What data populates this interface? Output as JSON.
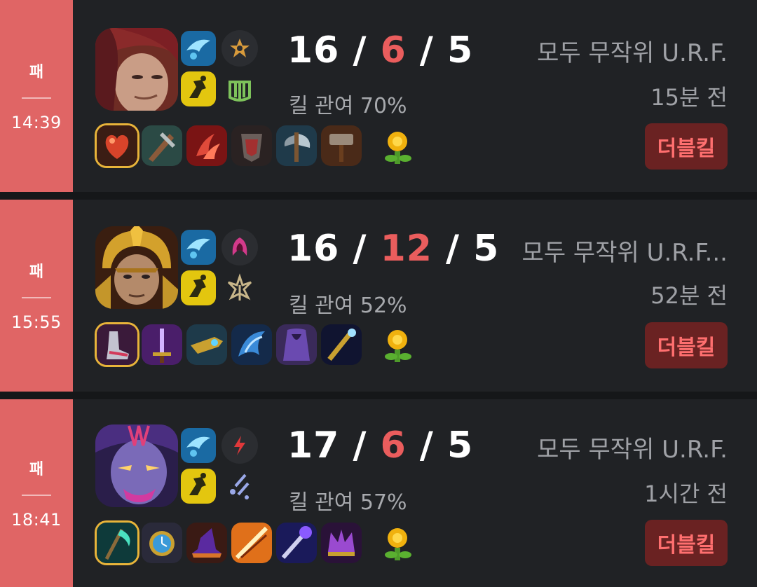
{
  "matches": [
    {
      "result": "패",
      "duration": "14:39",
      "kills": "16",
      "deaths": "6",
      "assists": "5",
      "kill_participation": "킬 관여 70%",
      "mode": "모두 무작위 U.R.F.",
      "time_ago": "15분 전",
      "badge": "더블킬",
      "champion_icon": "champion-portrait-red-hair",
      "spells": [
        "flash-icon",
        "ghost-icon"
      ],
      "runes": [
        "precision-keystone-icon",
        "resolve-rune-icon"
      ],
      "items": [
        "item-heart-icon",
        "item-blade-icon",
        "item-claw-icon",
        "item-armor-icon",
        "item-axe-icon",
        "item-hammer-icon",
        "ward-trinket-icon"
      ]
    },
    {
      "result": "패",
      "duration": "15:55",
      "kills": "16",
      "deaths": "12",
      "assists": "5",
      "kill_participation": "킬 관여 52%",
      "mode": "모두 무작위 U.R.F...",
      "time_ago": "52분 전",
      "badge": "더블킬",
      "champion_icon": "champion-portrait-golden-helmet",
      "spells": [
        "flash-icon",
        "ghost-icon"
      ],
      "runes": [
        "domination-keystone-icon",
        "inspiration-rune-icon"
      ],
      "items": [
        "item-boots-icon",
        "item-sword-icon",
        "item-gun-icon",
        "item-wing-icon",
        "item-cloak-icon",
        "item-staff-icon",
        "ward-trinket-icon"
      ]
    },
    {
      "result": "패",
      "duration": "18:41",
      "kills": "17",
      "deaths": "6",
      "assists": "5",
      "kill_participation": "킬 관여 57%",
      "mode": "모두 무작위 U.R.F.",
      "time_ago": "1시간 전",
      "badge": "더블킬",
      "champion_icon": "champion-portrait-purple-mask",
      "spells": [
        "flash-icon",
        "ghost-icon"
      ],
      "runes": [
        "electrocute-keystone-icon",
        "sorcery-rune-icon"
      ],
      "items": [
        "item-scythe-icon",
        "item-watch-icon",
        "item-hat-icon",
        "item-lance-icon",
        "item-wand-icon",
        "item-crown-icon",
        "ward-trinket-icon"
      ]
    }
  ],
  "colors": {
    "loss": "#e06565",
    "deaths": "#ea5d5d",
    "card": "#202225",
    "badge_bg": "#6a2222",
    "badge_text": "#ff6f6f"
  }
}
